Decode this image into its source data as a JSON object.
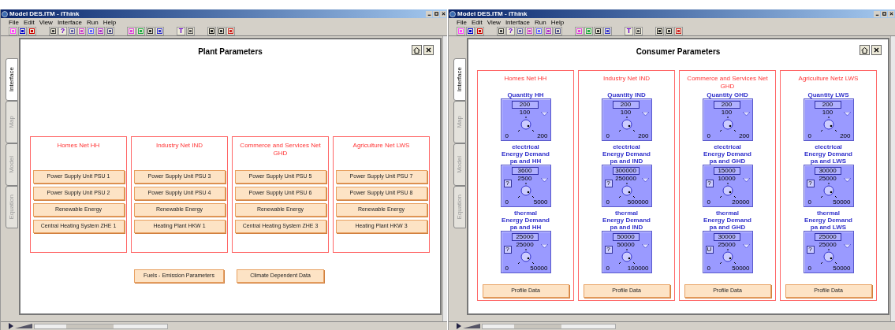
{
  "windows": [
    {
      "title": "Model DES.ITM - iThink",
      "menu": [
        "File",
        "Edit",
        "View",
        "Interface",
        "Run",
        "Help"
      ],
      "toolbar": [
        {
          "kind": "icon"
        },
        {
          "kind": "icon"
        },
        {
          "kind": "icon"
        },
        {
          "kind": "gap"
        },
        {
          "kind": "icon"
        },
        {
          "kind": "glyph",
          "text": "?"
        },
        {
          "kind": "icon"
        },
        {
          "kind": "icon"
        },
        {
          "kind": "icon"
        },
        {
          "kind": "icon"
        },
        {
          "kind": "icon"
        },
        {
          "kind": "gap"
        },
        {
          "kind": "icon"
        },
        {
          "kind": "icon"
        },
        {
          "kind": "icon"
        },
        {
          "kind": "icon"
        },
        {
          "kind": "gap"
        },
        {
          "kind": "glyph",
          "text": "T"
        },
        {
          "kind": "icon"
        },
        {
          "kind": "gap"
        },
        {
          "kind": "icon"
        },
        {
          "kind": "icon"
        },
        {
          "kind": "icon"
        }
      ],
      "side_tabs": [
        {
          "label": "Interface",
          "selected": true
        },
        {
          "label": "Map",
          "selected": false
        },
        {
          "label": "Model",
          "selected": false
        },
        {
          "label": "Equation",
          "selected": false
        }
      ],
      "page": {
        "kind": "plant",
        "title": "Plant Parameters",
        "groups": [
          {
            "title": "Homes Net HH",
            "buttons": [
              "Power Supply Unit PSU 1",
              "Power Supply Unit PSU 2",
              "Renewable Energy",
              "Central Heating System ZHE 1"
            ]
          },
          {
            "title": "Industry Net IND",
            "buttons": [
              "Power Supply Unit PSU 3",
              "Power Supply Unit PSU 4",
              "Renewable Energy",
              "Heating Plant HKW 1"
            ]
          },
          {
            "title": "Commerce and Services Net GHD",
            "buttons": [
              "Power Supply Unit PSU 5",
              "Power Supply Unit PSU 6",
              "Renewable Energy",
              "Central Heating System ZHE 3"
            ]
          },
          {
            "title": "Agriculture Net LWS",
            "buttons": [
              "Power Supply Unit PSU 7",
              "Power Supply Unit PSU 8",
              "Renewable Energy",
              "Heating Plant HKW 3"
            ]
          }
        ],
        "footer_buttons": [
          "Fuels - Emission Parameters",
          "Climate Dependent Data"
        ]
      }
    },
    {
      "title": "Model DES.ITM - iThink",
      "menu": [
        "File",
        "Edit",
        "View",
        "Interface",
        "Run",
        "Help"
      ],
      "toolbar": [
        {
          "kind": "icon"
        },
        {
          "kind": "icon"
        },
        {
          "kind": "icon"
        },
        {
          "kind": "gap"
        },
        {
          "kind": "icon"
        },
        {
          "kind": "glyph",
          "text": "?"
        },
        {
          "kind": "icon"
        },
        {
          "kind": "icon"
        },
        {
          "kind": "icon"
        },
        {
          "kind": "icon"
        },
        {
          "kind": "icon"
        },
        {
          "kind": "gap"
        },
        {
          "kind": "icon"
        },
        {
          "kind": "icon"
        },
        {
          "kind": "icon"
        },
        {
          "kind": "icon"
        },
        {
          "kind": "gap"
        },
        {
          "kind": "glyph",
          "text": "T"
        },
        {
          "kind": "icon"
        },
        {
          "kind": "gap"
        },
        {
          "kind": "icon"
        },
        {
          "kind": "icon"
        },
        {
          "kind": "icon"
        }
      ],
      "side_tabs": [
        {
          "label": "Interface",
          "selected": true
        },
        {
          "label": "Map",
          "selected": false
        },
        {
          "label": "Model",
          "selected": false
        },
        {
          "label": "Equation",
          "selected": false
        }
      ],
      "page": {
        "kind": "consumer",
        "title": "Consumer Parameters",
        "groups": [
          {
            "title": "Homes Net HH",
            "knobs": [
              {
                "label_lines": [
                  "Quantity HH"
                ],
                "value": "200",
                "mid": "100",
                "min": "0",
                "max": "200"
              },
              {
                "label_lines": [
                  "electrical",
                  "Energy Demand",
                  "pa and HH"
                ],
                "value": "3600",
                "mid": "2500",
                "min": "0",
                "max": "5000",
                "help": "?"
              },
              {
                "label_lines": [
                  "thermal",
                  "Energy Demand",
                  "pa and HH"
                ],
                "value": "25000",
                "mid": "25000",
                "min": "0",
                "max": "50000",
                "help": "?"
              }
            ],
            "button": "Profile Data"
          },
          {
            "title": "Industry Net IND",
            "knobs": [
              {
                "label_lines": [
                  "Quantity IND"
                ],
                "value": "200",
                "mid": "100",
                "min": "0",
                "max": "200"
              },
              {
                "label_lines": [
                  "electrical",
                  "Energy Demand",
                  "pa and IND"
                ],
                "value": "300000",
                "mid": "250000",
                "min": "0",
                "max": "500000",
                "help": "?"
              },
              {
                "label_lines": [
                  "thermal",
                  "Energy Demand",
                  "pa and IND"
                ],
                "value": "50000",
                "mid": "50000",
                "min": "0",
                "max": "100000",
                "help": "?"
              }
            ],
            "button": "Profile Data"
          },
          {
            "title": "Commerce and Services Net GHD",
            "knobs": [
              {
                "label_lines": [
                  "Quantity GHD"
                ],
                "value": "200",
                "mid": "100",
                "min": "0",
                "max": "200"
              },
              {
                "label_lines": [
                  "electrical",
                  "Energy Demand",
                  "pa and GHD"
                ],
                "value": "15000",
                "mid": "10000",
                "min": "0",
                "max": "20000",
                "help": "?"
              },
              {
                "label_lines": [
                  "thermal",
                  "Energy Demand",
                  "pa and GHD"
                ],
                "value": "30000",
                "mid": "25000",
                "min": "0",
                "max": "50000",
                "help": "U"
              }
            ],
            "button": "Profile Data"
          },
          {
            "title": "Agriculture Netz LWS",
            "knobs": [
              {
                "label_lines": [
                  "Quantity LWS"
                ],
                "value": "200",
                "mid": "100",
                "min": "0",
                "max": "200"
              },
              {
                "label_lines": [
                  "electrical",
                  "Energy Demand",
                  "pa and LWS"
                ],
                "value": "30000",
                "mid": "25000",
                "min": "0",
                "max": "50000",
                "help": "?"
              },
              {
                "label_lines": [
                  "thermal",
                  "Energy Demand",
                  "pa and LWS"
                ],
                "value": "25000",
                "mid": "25000",
                "min": "0",
                "max": "50000",
                "help": "?"
              }
            ],
            "button": "Profile Data"
          }
        ]
      }
    }
  ]
}
